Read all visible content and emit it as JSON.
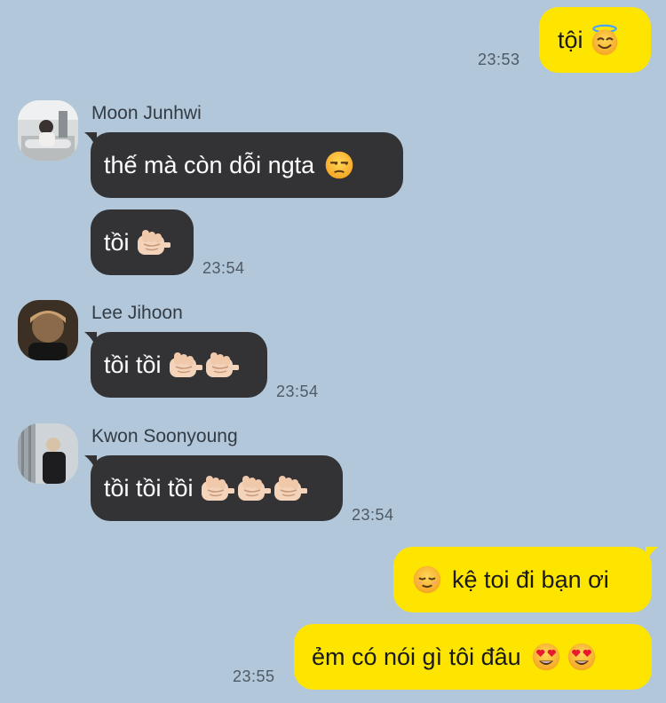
{
  "chat": {
    "messages": [
      {
        "text": "tội",
        "emoji": [
          "innocent-emoji"
        ],
        "time": "23:53"
      },
      {
        "sender": "Moon Junhwi",
        "text": "thế mà còn dỗi ngta",
        "emoji": [
          "unamused-emoji"
        ]
      },
      {
        "text": "tồi",
        "emoji": [
          "pointing-fist-emoji"
        ],
        "time": "23:54"
      },
      {
        "sender": "Lee Jihoon",
        "text": "tồi tồi",
        "emoji": [
          "pointing-fist-emoji",
          "pointing-fist-emoji"
        ],
        "time": "23:54"
      },
      {
        "sender": "Kwon Soonyoung",
        "text": "tồi tồi tồi",
        "emoji": [
          "pointing-fist-emoji",
          "pointing-fist-emoji",
          "pointing-fist-emoji"
        ],
        "time": "23:54"
      },
      {
        "text": "kệ toi đi bạn ơi",
        "emoji": [
          "relieved-emoji"
        ]
      },
      {
        "text": "ẻm có nói gì tôi đâu",
        "emoji": [
          "heart-eyes-emoji",
          "heart-eyes-emoji"
        ],
        "time": "23:55"
      }
    ]
  },
  "colors": {
    "background": "#b2c7d9",
    "outgoing_bubble": "#fee500",
    "incoming_bubble": "#333336"
  }
}
